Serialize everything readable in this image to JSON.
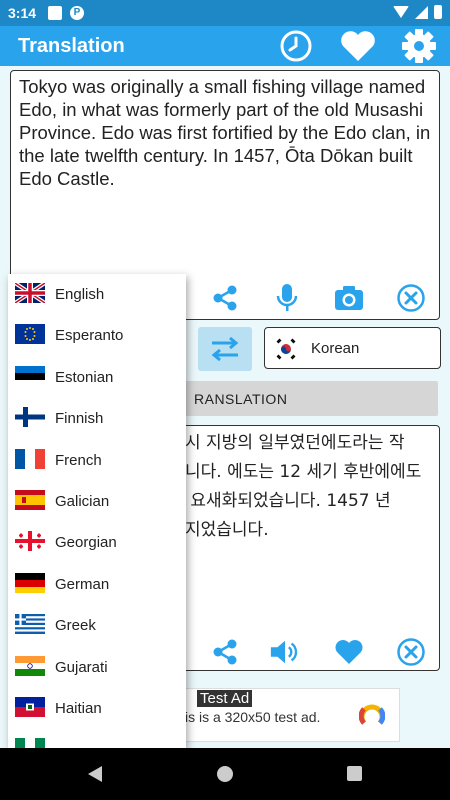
{
  "status_bar": {
    "time": "3:14"
  },
  "app_bar": {
    "title": "Translation",
    "icons": [
      "history-icon",
      "heart-icon",
      "settings-icon"
    ]
  },
  "source": {
    "text": "Tokyo was originally a small fishing village named Edo, in what was formerly part of the old Musashi Province. Edo was first fortified by the Edo clan, in the late twelfth century. In 1457, Ōta Dōkan built Edo Castle.",
    "icons": [
      "share-icon",
      "microphone-icon",
      "camera-icon",
      "clear-icon"
    ]
  },
  "target_language": {
    "label": "Korean"
  },
  "translate_button": {
    "label": "RANSLATION"
  },
  "target": {
    "text": "시 지방의 일부였던에도라는 작\n니다. 에도는 12 세기 후반에에도\n 요새화되었습니다. 1457 년\n지었습니다.",
    "icons": [
      "share-icon",
      "speaker-icon",
      "heart-icon",
      "clear-icon"
    ]
  },
  "ad": {
    "badge": "Test Ad",
    "message": "is is a 320x50 test ad."
  },
  "dropdown": {
    "items": [
      {
        "label": "English",
        "flag": "uk"
      },
      {
        "label": "Esperanto",
        "flag": "esperanto"
      },
      {
        "label": "Estonian",
        "flag": "estonia"
      },
      {
        "label": "Finnish",
        "flag": "finland"
      },
      {
        "label": "French",
        "flag": "france"
      },
      {
        "label": "Galician",
        "flag": "spain"
      },
      {
        "label": "Georgian",
        "flag": "georgia"
      },
      {
        "label": "German",
        "flag": "germany"
      },
      {
        "label": "Greek",
        "flag": "greece"
      },
      {
        "label": "Gujarati",
        "flag": "india"
      },
      {
        "label": "Haitian",
        "flag": "haiti"
      }
    ]
  },
  "colors": {
    "status_bar": "#1e88c7",
    "app_bar": "#29a3ec",
    "accent_icon": "#29a3ec",
    "background": "#eaf7fb"
  }
}
